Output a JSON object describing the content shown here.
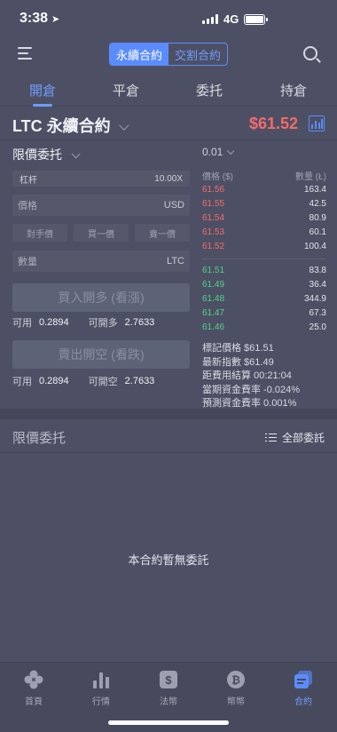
{
  "status": {
    "time": "3:38",
    "network": "4G"
  },
  "nav": {
    "tab_perpetual": "永續合約",
    "tab_delivery": "交割合約"
  },
  "tabs": [
    "開倉",
    "平倉",
    "委托",
    "持倉"
  ],
  "contract": {
    "name": "LTC 永續合約",
    "price": "$61.52"
  },
  "order_form": {
    "order_type": "限價委托",
    "leverage_label": "杠杆",
    "leverage_value": "10.00X",
    "price_placeholder": "價格",
    "price_unit": "USD",
    "quick_buttons": [
      "對手價",
      "買一價",
      "賣一價"
    ],
    "qty_placeholder": "數量",
    "qty_unit": "LTC",
    "buy_label": "買入開多 (看漲)",
    "sell_label": "賣出開空 (看跌)",
    "buy_avail_label": "可用",
    "buy_avail_value": "0.2894",
    "buy_open_label": "可開多",
    "buy_open_value": "2.7633",
    "sell_avail_label": "可用",
    "sell_avail_value": "0.2894",
    "sell_open_label": "可開空",
    "sell_open_value": "2.7633"
  },
  "orderbook": {
    "depth": "0.01",
    "head_price": "價格 ($)",
    "head_qty": "數量 (Ł)",
    "asks": [
      {
        "p": "61.56",
        "q": "163.4"
      },
      {
        "p": "61.55",
        "q": "42.5"
      },
      {
        "p": "61.54",
        "q": "80.9"
      },
      {
        "p": "61.53",
        "q": "60.1"
      },
      {
        "p": "61.52",
        "q": "100.4"
      }
    ],
    "bids": [
      {
        "p": "61.51",
        "q": "83.8"
      },
      {
        "p": "61.49",
        "q": "36.4"
      },
      {
        "p": "61.48",
        "q": "344.9"
      },
      {
        "p": "61.47",
        "q": "67.3"
      },
      {
        "p": "61.46",
        "q": "25.0"
      }
    ],
    "stats": [
      "標記價格 $61.51",
      "最新指數 $61.49",
      "距費用結算 00:21:04",
      "當期資金費率 -0.024%",
      "預測資金費率 0.001%"
    ]
  },
  "limit_orders": {
    "title": "限價委托",
    "all_label": "全部委託",
    "empty_text": "本合約暫無委託"
  },
  "bottom_nav": [
    "首頁",
    "行情",
    "法幣",
    "幣幣",
    "合約"
  ],
  "colors": {
    "accent": "#5b8cff",
    "ask": "#f36b6b",
    "bid": "#4fd38c"
  }
}
